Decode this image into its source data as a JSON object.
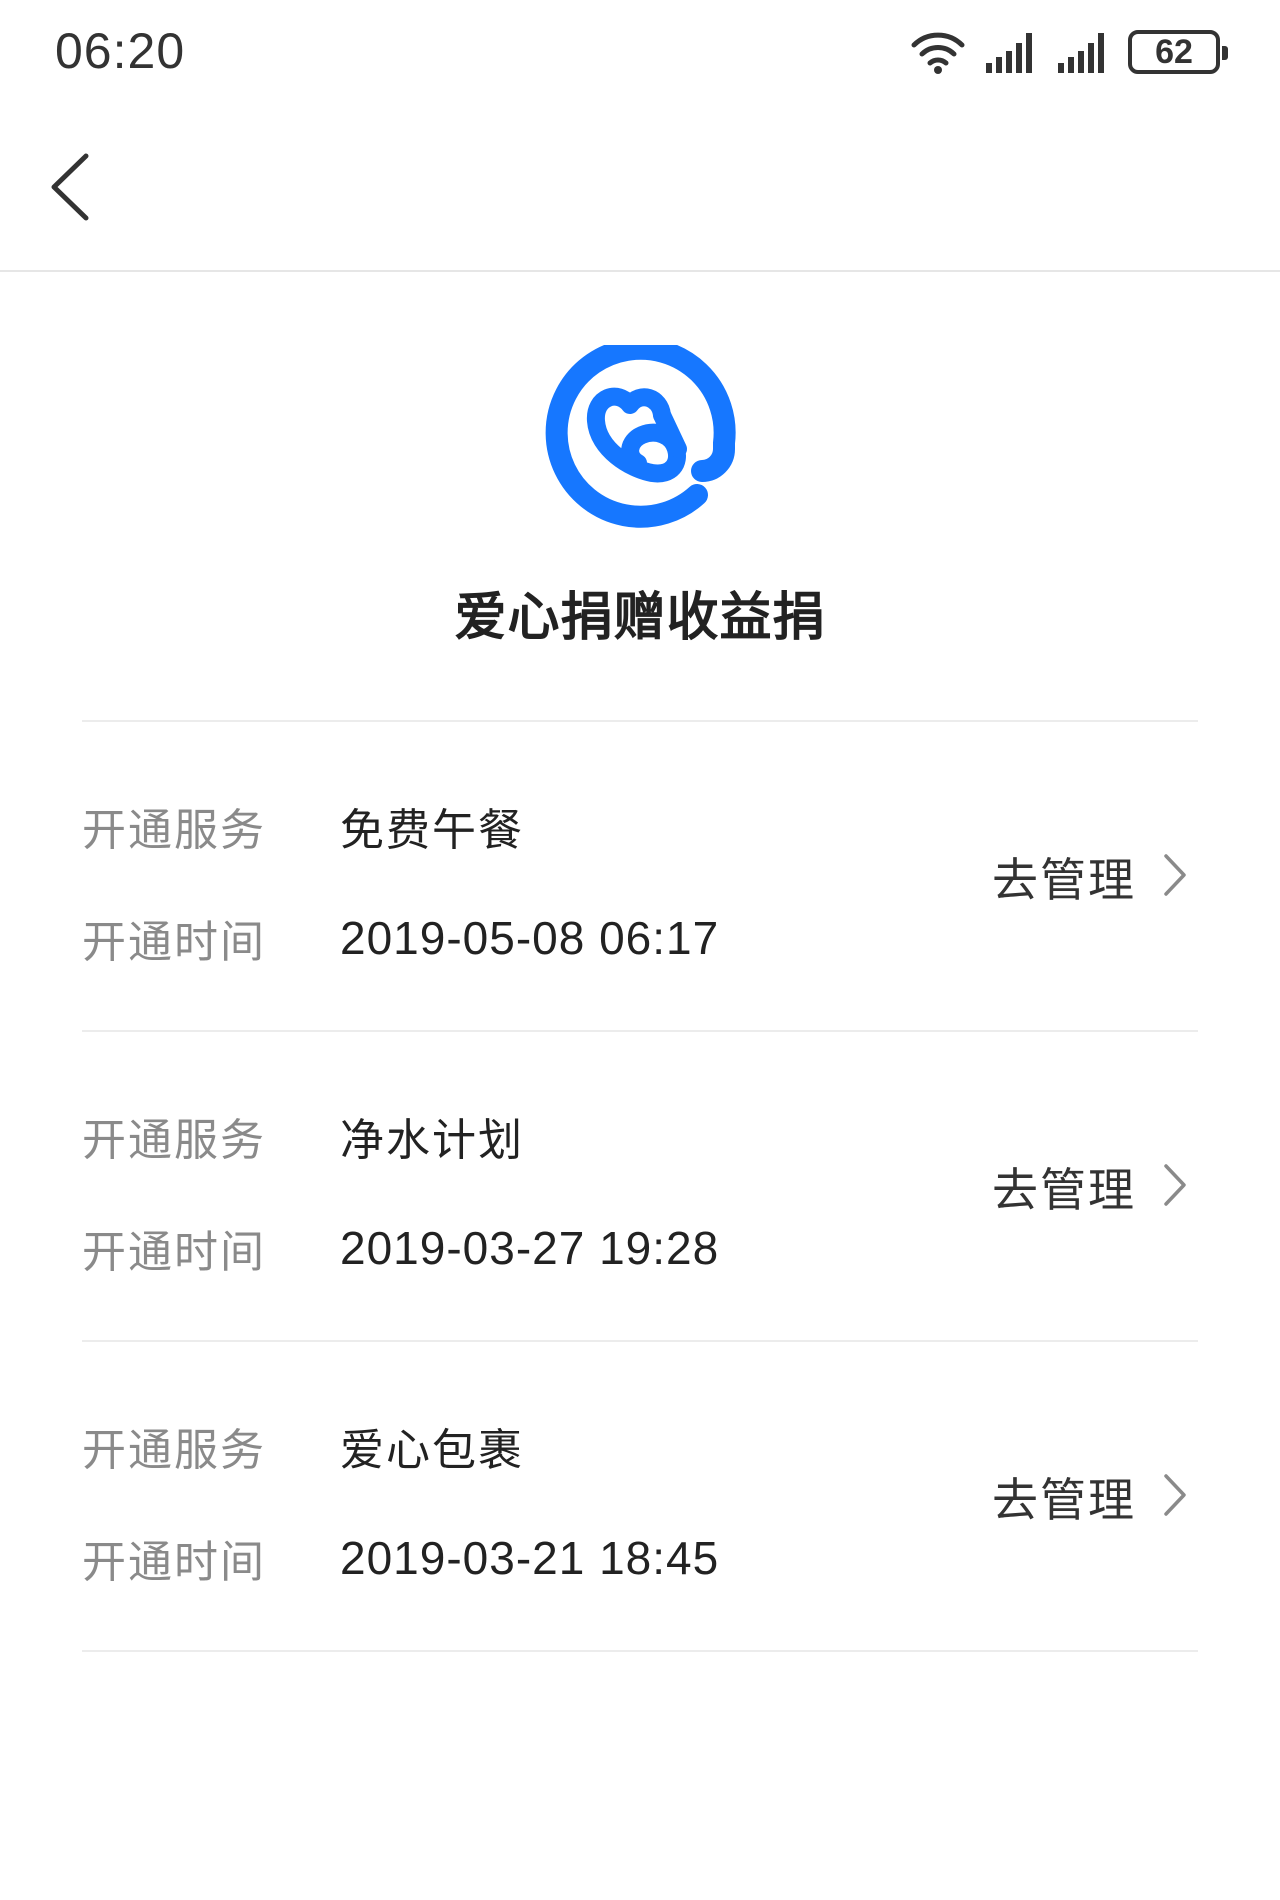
{
  "status_bar": {
    "time": "06:20",
    "battery": "62",
    "icons": [
      "wifi-icon",
      "signal-icon",
      "signal-icon",
      "battery-icon"
    ]
  },
  "nav": {
    "back_icon": "chevron-left-icon"
  },
  "header": {
    "logo_icon": "charity-heart-logo-icon",
    "title": "爱心捐赠收益捐"
  },
  "labels": {
    "service": "开通服务",
    "time": "开通时间",
    "manage": "去管理"
  },
  "items": [
    {
      "service": "免费午餐",
      "time": "2019-05-08 06:17"
    },
    {
      "service": "净水计划",
      "time": "2019-03-27 19:28"
    },
    {
      "service": "爱心包裹",
      "time": "2019-03-21 18:45"
    }
  ],
  "colors": {
    "brand_blue": "#1677FF",
    "text_primary": "#222222",
    "text_secondary": "#8A8A8A",
    "divider": "#ECECEC"
  }
}
